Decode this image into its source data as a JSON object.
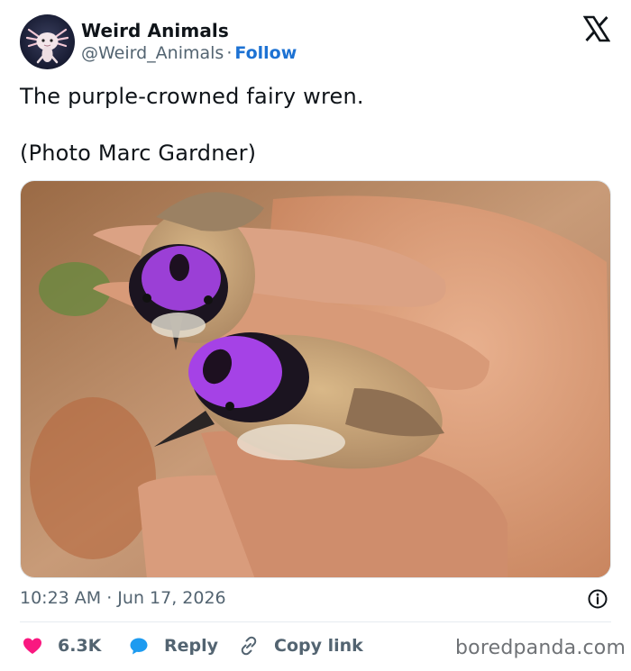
{
  "author": {
    "display_name": "Weird Animals",
    "handle": "@Weird_Animals",
    "separator": "·",
    "follow_label": "Follow",
    "avatar_icon": "axolotl-avatar"
  },
  "tweet": {
    "line1": "The purple-crowned fairy wren.",
    "line2": "(Photo Marc Gardner)",
    "photo_alt_icon": "fairy-wren-photo",
    "timestamp": "10:23 AM · Jun 17, 2026"
  },
  "actions": {
    "like_count": "6.3K",
    "reply_label": "Reply",
    "copy_label": "Copy link"
  },
  "watermark": "boredpanda.com",
  "colors": {
    "accent_blue": "#1d72d3",
    "heart_pink": "#f91880",
    "reply_blue": "#1d9bf0",
    "muted_text": "#536471",
    "text": "#0f1419"
  }
}
